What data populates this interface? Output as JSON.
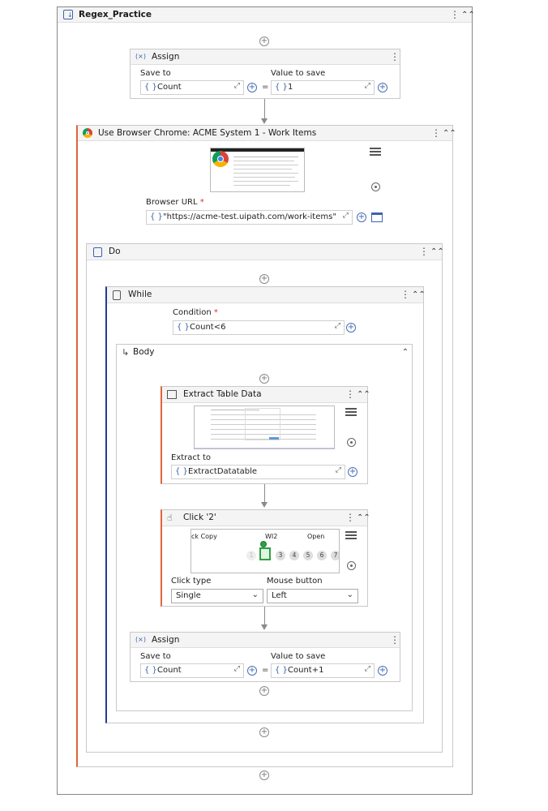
{
  "workflow": {
    "title": "Regex_Practice"
  },
  "assign1": {
    "title": "Assign",
    "save_to_label": "Save to",
    "value_label": "Value to save",
    "save_to_value": "Count",
    "value": "1",
    "equals": "="
  },
  "browser": {
    "title": "Use Browser Chrome: ACME System 1 - Work Items",
    "url_label": "Browser URL",
    "required_mark": "*",
    "url_value": "\"https://acme-test.uipath.com/work-items\""
  },
  "do_scope": {
    "title": "Do"
  },
  "while_loop": {
    "title": "While",
    "condition_label": "Condition",
    "required_mark": "*",
    "condition_value": "Count<6"
  },
  "body": {
    "title": "Body"
  },
  "extract": {
    "title": "Extract Table Data",
    "extract_to_label": "Extract to",
    "extract_to_value": "ExtractDatatable"
  },
  "click": {
    "title": "Click '2'",
    "preview_left": "ck Copy",
    "preview_mid": "WI2",
    "preview_right": "Open",
    "pages": [
      "1",
      "2",
      "3",
      "4",
      "5",
      "6",
      "7"
    ],
    "click_type_label": "Click type",
    "mouse_button_label": "Mouse button",
    "click_type_value": "Single",
    "mouse_button_value": "Left"
  },
  "assign2": {
    "title": "Assign",
    "save_to_label": "Save to",
    "value_label": "Value to save",
    "save_to_value": "Count",
    "value": "Count+1",
    "equals": "="
  },
  "icons": {
    "kebab": "⋮",
    "collapse": "⌃⌃",
    "collapse_single": "⌃",
    "plus": "+",
    "brace": "{ }",
    "expand": "⤢",
    "chevron": "⌄",
    "body_arrow": "↳",
    "assign_badge": "(×)"
  },
  "colors": {
    "accent_orange": "#e0643c",
    "accent_blue": "#1f3f8f",
    "brand_blue": "#3a63b0"
  }
}
